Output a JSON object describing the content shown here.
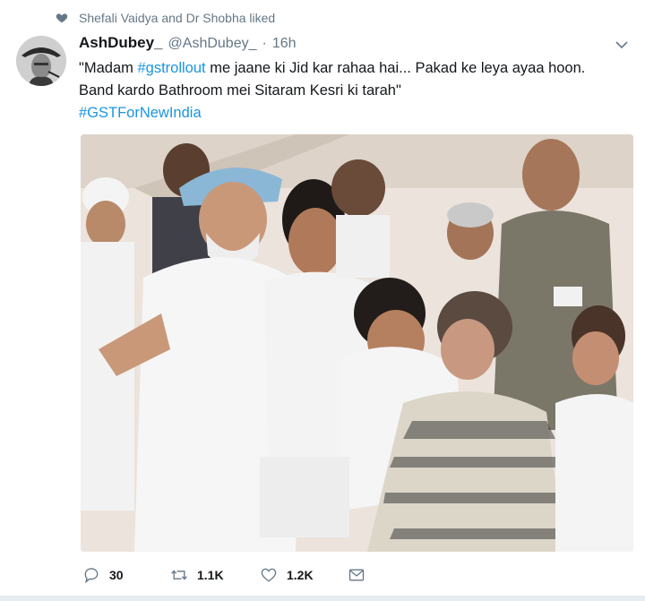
{
  "social_context": {
    "text": "Shefali Vaidya and Dr Shobha liked",
    "icon": "heart-icon"
  },
  "author": {
    "display_name": "AshDubey_",
    "handle": "@AshDubey_",
    "separator": "·",
    "timestamp": "16h"
  },
  "tweet": {
    "line1_prefix": "\"Madam ",
    "line1_hashtag": "#gstrollout",
    "line1_suffix": " me jaane ki Jid kar rahaa hai... Pakad ke leya ayaa hoon.",
    "line2": "Band kardo Bathroom mei Sitaram Kesri ki tarah\"",
    "line3_hashtag": "#GSTForNewIndia"
  },
  "actions": {
    "reply": {
      "icon": "reply-icon",
      "count": "30"
    },
    "retweet": {
      "icon": "retweet-icon",
      "count": "1.1K"
    },
    "like": {
      "icon": "heart-outline-icon",
      "count": "1.2K"
    },
    "message": {
      "icon": "envelope-icon"
    }
  },
  "colors": {
    "link": "#1b95e0",
    "secondary_text": "#657786",
    "primary_text": "#14171a"
  }
}
